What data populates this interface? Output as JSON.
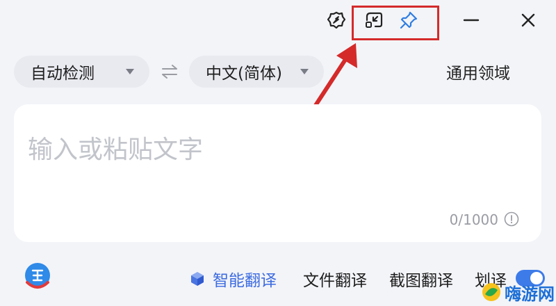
{
  "titlebar": {
    "icons": [
      "settings-icon",
      "mini-mode-icon",
      "pin-icon",
      "minimize-icon",
      "close-icon"
    ]
  },
  "language_bar": {
    "source_language": "自动检测",
    "target_language": "中文(简体)",
    "domain_label": "通用领域"
  },
  "input": {
    "placeholder": "输入或粘贴文字",
    "value": "",
    "char_count": "0/1000"
  },
  "bottom_bar": {
    "smart_translate": "智能翻译",
    "file_translate": "文件翻译",
    "screenshot_translate": "截图翻译",
    "select_translate": "划译",
    "select_translate_enabled": true
  },
  "watermark": {
    "text": "嗨游网"
  },
  "colors": {
    "background": "#f3f4f8",
    "accent": "#3d6ce0",
    "highlight": "#d42a2a"
  }
}
